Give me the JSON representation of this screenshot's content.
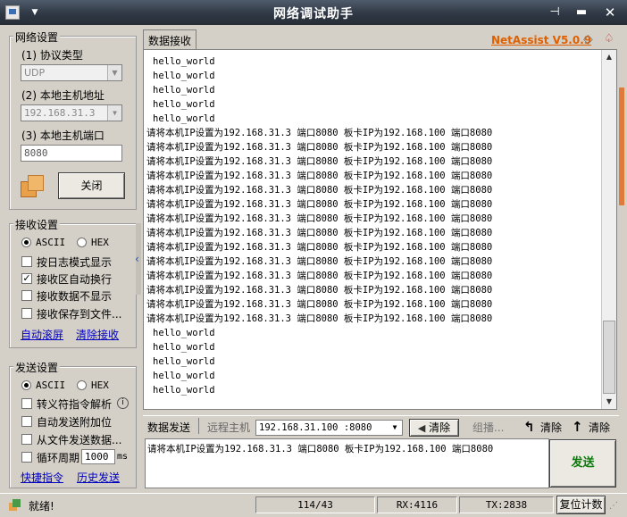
{
  "window": {
    "title": "网络调试助手",
    "icons": [
      "app-icon",
      "chevron-down-icon",
      "pin-icon",
      "minimize-icon",
      "close-icon"
    ]
  },
  "brand": {
    "label": "NetAssist V5.0.9",
    "color": "#e06000"
  },
  "network": {
    "group_title": "网络设置",
    "protocol_label": "(1) 协议类型",
    "protocol_value": "UDP",
    "host_label": "(2) 本地主机地址",
    "host_value": "192.168.31.3",
    "port_label": "(3) 本地主机端口",
    "port_value": "8080",
    "close_button": "关闭"
  },
  "receive_settings": {
    "group_title": "接收设置",
    "ascii_label": "ASCII",
    "hex_label": "HEX",
    "ascii_selected": true,
    "options": [
      {
        "label": "按日志模式显示",
        "checked": false
      },
      {
        "label": "接收区自动换行",
        "checked": true
      },
      {
        "label": "接收数据不显示",
        "checked": false
      },
      {
        "label": "接收保存到文件...",
        "checked": false
      }
    ],
    "link_autoscroll": "自动滚屏",
    "link_clear": "清除接收"
  },
  "send_settings": {
    "group_title": "发送设置",
    "ascii_label": "ASCII",
    "hex_label": "HEX",
    "ascii_selected": true,
    "options": [
      {
        "label": "转义符指令解析",
        "checked": false
      },
      {
        "label": "自动发送附加位",
        "checked": false
      },
      {
        "label": "从文件发送数据...",
        "checked": false
      },
      {
        "label": "循环周期",
        "checked": false
      }
    ],
    "cycle_value": "1000",
    "cycle_unit": "ms",
    "link_shortcut": "快捷指令",
    "link_history": "历史发送"
  },
  "receive": {
    "tab_label": "数据接收",
    "lines": [
      "hello_world",
      "hello_world",
      "hello_world",
      "hello_world",
      "hello_world",
      "请将本机IP设置为192.168.31.3 端口8080 板卡IP为192.168.100 端口8080",
      "请将本机IP设置为192.168.31.3 端口8080 板卡IP为192.168.100 端口8080",
      "请将本机IP设置为192.168.31.3 端口8080 板卡IP为192.168.100 端口8080",
      "请将本机IP设置为192.168.31.3 端口8080 板卡IP为192.168.100 端口8080",
      "请将本机IP设置为192.168.31.3 端口8080 板卡IP为192.168.100 端口8080",
      "请将本机IP设置为192.168.31.3 端口8080 板卡IP为192.168.100 端口8080",
      "请将本机IP设置为192.168.31.3 端口8080 板卡IP为192.168.100 端口8080",
      "请将本机IP设置为192.168.31.3 端口8080 板卡IP为192.168.100 端口8080",
      "请将本机IP设置为192.168.31.3 端口8080 板卡IP为192.168.100 端口8080",
      "请将本机IP设置为192.168.31.3 端口8080 板卡IP为192.168.100 端口8080",
      "请将本机IP设置为192.168.31.3 端口8080 板卡IP为192.168.100 端口8080",
      "请将本机IP设置为192.168.31.3 端口8080 板卡IP为192.168.100 端口8080",
      "请将本机IP设置为192.168.31.3 端口8080 板卡IP为192.168.100 端口8080",
      "请将本机IP设置为192.168.31.3 端口8080 板卡IP为192.168.100 端口8080",
      "hello_world",
      "hello_world",
      "hello_world",
      "hello_world",
      "hello_world"
    ]
  },
  "send_toolbar": {
    "tab_label": "数据发送",
    "remote_label": "远程主机",
    "remote_value": "192.168.31.100 :8080",
    "clear_label": "清除",
    "group_send_label": "组播...",
    "clear2_label": "清除",
    "clear3_label": "清除"
  },
  "send": {
    "text": "请将本机IP设置为192.168.31.3 端口8080 板卡IP为192.168.100 端口8080",
    "send_button": "发送"
  },
  "status": {
    "ready": "就绪!",
    "count": "114/43",
    "rx": "RX:4116",
    "tx": "TX:2838",
    "reset_label": "复位计数"
  }
}
